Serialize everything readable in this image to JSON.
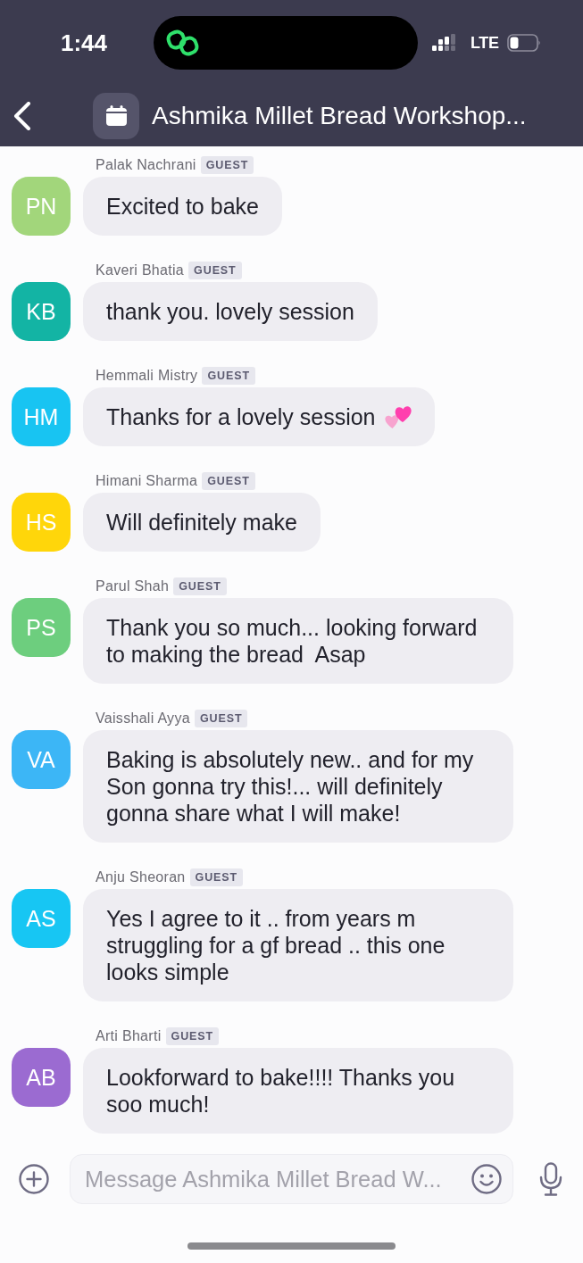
{
  "status_bar": {
    "time": "1:44",
    "network": "LTE"
  },
  "header": {
    "title": "Ashmika Millet Bread Workshop..."
  },
  "messages": [
    {
      "initials": "PN",
      "color": "#a2d67b",
      "author": "Palak Nachrani",
      "badge": "GUEST",
      "kind": "plain",
      "text": "Excited to bake"
    },
    {
      "initials": "KB",
      "color": "#13b4a4",
      "author": "Kaveri Bhatia",
      "badge": "GUEST",
      "kind": "plain",
      "text": "thank you. lovely session"
    },
    {
      "initials": "HM",
      "color": "#18c4f2",
      "author": "Hemmali Mistry",
      "badge": "GUEST",
      "kind": "emoji",
      "text": "Thanks for a lovely session"
    },
    {
      "initials": "HS",
      "color": "#ffd60a",
      "author": "Himani Sharma",
      "badge": "GUEST",
      "kind": "plain",
      "text": "Will definitely make"
    },
    {
      "initials": "PS",
      "color": "#6dce7e",
      "author": "Parul Shah",
      "badge": "GUEST",
      "kind": "plain",
      "text": "Thank you so much... looking forward to making the bread  Asap"
    },
    {
      "initials": "VA",
      "color": "#3cb6f6",
      "author": "Vaisshali Ayya",
      "badge": "GUEST",
      "kind": "plain",
      "text": "Baking is absolutely new.. and for my Son gonna try this!... will definitely gonna share what I will make!"
    },
    {
      "initials": "AS",
      "color": "#17c6f3",
      "author": "Anju Sheoran",
      "badge": "GUEST",
      "kind": "plain",
      "text": "Yes I agree to it .. from years m struggling for a gf bread .. this one looks simple"
    },
    {
      "initials": "AB",
      "color": "#9b6bd1",
      "author": "Arti Bharti",
      "badge": "GUEST",
      "kind": "plain",
      "text": "Lookforward to bake!!!! Thanks you soo much!"
    }
  ],
  "composer": {
    "placeholder": "Message Ashmika Millet Bread W..."
  }
}
